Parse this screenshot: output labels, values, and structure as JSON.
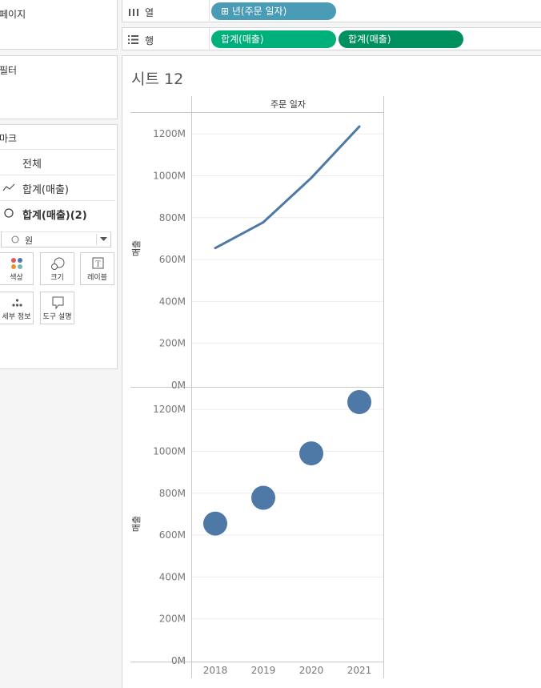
{
  "panels": {
    "pages": "페이지",
    "filters": "필터",
    "marks": "마크"
  },
  "shelves": {
    "columns": {
      "label": "열",
      "pill": "⊞ 년(주문 일자)"
    },
    "rows": {
      "label": "행",
      "pills": [
        "합계(매출)",
        "합계(매출)"
      ]
    }
  },
  "marks": {
    "rows": [
      {
        "label": "전체"
      },
      {
        "label": "합계(매출)"
      },
      {
        "label": "합계(매출)(2)"
      }
    ],
    "mark_type": "원",
    "cards": [
      {
        "label": "색상",
        "icon": "color-dots-icon"
      },
      {
        "label": "크기",
        "icon": "size-icon"
      },
      {
        "label": "레이블",
        "icon": "label-icon"
      },
      {
        "label": "세부 정보",
        "icon": "detail-icon"
      },
      {
        "label": "도구 설명",
        "icon": "tooltip-icon"
      }
    ]
  },
  "sheet": {
    "title": "시트 12",
    "column_header": "주문 일자"
  },
  "chart_data": [
    {
      "type": "line",
      "x": [
        "2018",
        "2019",
        "2020",
        "2021"
      ],
      "values": [
        655,
        778,
        990,
        1235
      ],
      "ylabel": "매출",
      "ylim": [
        0,
        1300
      ],
      "yticks": [
        "0M",
        "200M",
        "400M",
        "600M",
        "800M",
        "1000M",
        "1200M"
      ],
      "color": "#4e79a7"
    },
    {
      "type": "scatter",
      "x": [
        "2018",
        "2019",
        "2020",
        "2021"
      ],
      "values": [
        655,
        778,
        990,
        1235
      ],
      "ylabel": "매출",
      "ylim": [
        0,
        1300
      ],
      "yticks": [
        "0M",
        "200M",
        "400M",
        "600M",
        "800M",
        "1000M",
        "1200M"
      ],
      "color": "#4e79a7"
    }
  ],
  "colors": {
    "column_pill": "#4a9bb5",
    "row_pill_1": "#00b07a",
    "row_pill_2": "#009060",
    "series": "#4e79a7"
  }
}
